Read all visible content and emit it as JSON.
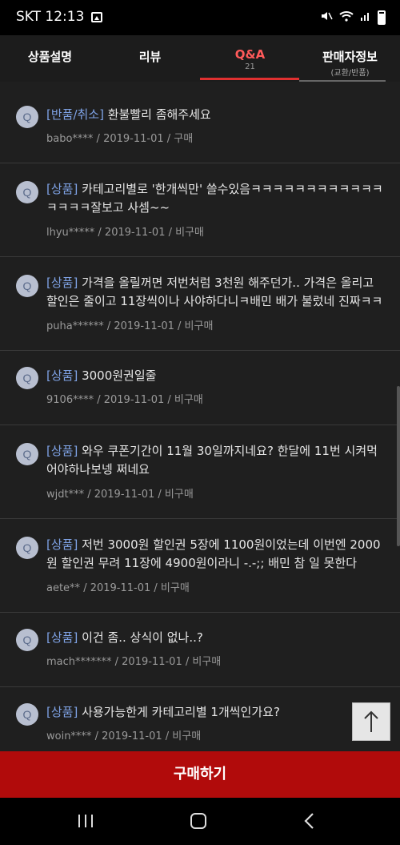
{
  "status_bar": {
    "carrier_time": "SKT 12:13"
  },
  "tabs": [
    {
      "label": "상품설명",
      "sub": ""
    },
    {
      "label": "리뷰",
      "sub": ""
    },
    {
      "label": "Q&A",
      "sub": "21"
    },
    {
      "label": "판매자정보",
      "sub": "(교환/반품)"
    }
  ],
  "questions": [
    {
      "badge": "Q",
      "category": "[반품/취소]",
      "text": " 환불빨리 좀해주세요",
      "meta": "babo**** / 2019-11-01 / 구매"
    },
    {
      "badge": "Q",
      "category": "[상품]",
      "text": " 카테고리별로 '한개씩만' 쓸수있음ㅋㅋㅋㅋㅋㅋㅋㅋㅋㅋㅋㅋㅋㅋㅋㅋ잘보고 사셈~~",
      "meta": "lhyu***** / 2019-11-01 / 비구매"
    },
    {
      "badge": "Q",
      "category": "[상품]",
      "text": " 가격을 올릴꺼면 저번처럼 3천원 해주던가.. 가격은 올리고 할인은 줄이고 11장씩이나 사야하다니ㅋ배민 배가 불렀네 진짜ㅋㅋ",
      "meta": "puha****** / 2019-11-01 / 비구매"
    },
    {
      "badge": "Q",
      "category": "[상품]",
      "text": " 3000원권일줄",
      "meta": "9106**** / 2019-11-01 / 비구매"
    },
    {
      "badge": "Q",
      "category": "[상품]",
      "text": " 와우 쿠폰기간이 11월 30일까지네요? 한달에 11번 시켜먹어야하나보넹 쩌네요",
      "meta": "wjdt*** / 2019-11-01 / 비구매"
    },
    {
      "badge": "Q",
      "category": "[상품]",
      "text": " 저번 3000원 할인권 5장에 1100원이었는데 이번엔 2000원 할인권 무려 11장에 4900원이라니 -.-;; 배민 참 일 못한다",
      "meta": "aete** / 2019-11-01 / 비구매"
    },
    {
      "badge": "Q",
      "category": "[상품]",
      "text": " 이건 좀.. 상식이 없나..?",
      "meta": "mach******* / 2019-11-01 / 비구매"
    },
    {
      "badge": "Q",
      "category": "[상품]",
      "text": " 사용가능한게 카테고리별 1개씩인가요?",
      "meta": "woin**** / 2019-11-01 / 비구매"
    }
  ],
  "buy_button": "구매하기",
  "icons": {
    "status": [
      "image-icon",
      "mute-icon",
      "wifi-icon",
      "signal-icon",
      "battery-icon"
    ],
    "scroll_top": "arrow-up-icon",
    "nav": [
      "recent-apps-icon",
      "home-icon",
      "back-icon"
    ]
  },
  "colors": {
    "accent": "#ff5a5a",
    "category": "#7fa3e6",
    "buy": "#b10b0b"
  }
}
